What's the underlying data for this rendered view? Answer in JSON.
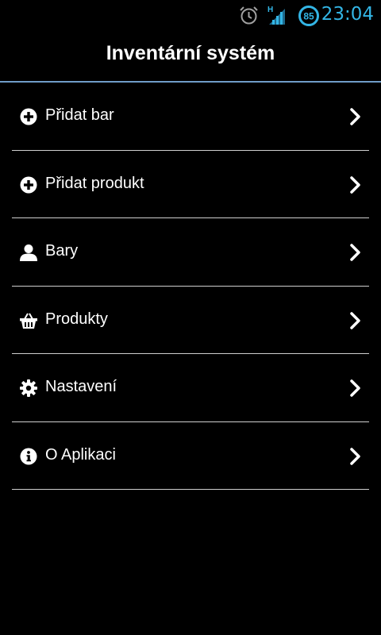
{
  "status_bar": {
    "time": "23:04",
    "battery_level": "85",
    "network_type": "H",
    "icons": [
      "alarm-icon",
      "signal-icon",
      "battery-icon"
    ],
    "accent_color": "#33b5e5"
  },
  "action_bar": {
    "title": "Inventární systém",
    "divider_color": "#6f9cc7"
  },
  "menu": {
    "items": [
      {
        "label": "Přidat bar",
        "icon": "plus-circle-icon"
      },
      {
        "label": "Přidat produkt",
        "icon": "plus-circle-icon"
      },
      {
        "label": "Bary",
        "icon": "person-icon"
      },
      {
        "label": "Produkty",
        "icon": "basket-icon"
      },
      {
        "label": "Nastavení",
        "icon": "gear-icon"
      },
      {
        "label": "O Aplikaci",
        "icon": "info-icon"
      }
    ]
  }
}
